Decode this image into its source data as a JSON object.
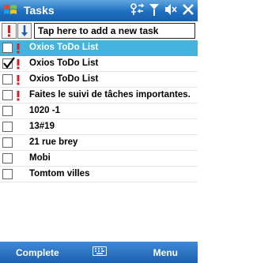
{
  "title_bar": {
    "title": "Tasks",
    "icons": [
      "windows-flag-icon",
      "connectivity-icon",
      "signal-icon",
      "volume-icon",
      "close-icon"
    ]
  },
  "toolbar": {
    "priority_icon": "exclamation-icon",
    "sort_icon": "sort-arrow-icon",
    "new_task_placeholder": "Tap here to add a new task"
  },
  "tasks": [
    {
      "label": "Oxios ToDo List",
      "checked": false,
      "high_priority": true,
      "selected": true
    },
    {
      "label": "Oxios ToDo List",
      "checked": true,
      "high_priority": true,
      "selected": false
    },
    {
      "label": "Oxios ToDo List",
      "checked": false,
      "high_priority": true,
      "selected": false
    },
    {
      "label": "Faites le suivi de tâches importantes.",
      "checked": false,
      "high_priority": true,
      "selected": false
    },
    {
      "label": "1020 -1",
      "checked": false,
      "high_priority": false,
      "selected": false
    },
    {
      "label": "13#19",
      "checked": false,
      "high_priority": false,
      "selected": false
    },
    {
      "label": "21 rue brey",
      "checked": false,
      "high_priority": false,
      "selected": false
    },
    {
      "label": "Mobi",
      "checked": false,
      "high_priority": false,
      "selected": false
    },
    {
      "label": "Tomtom villes",
      "checked": false,
      "high_priority": false,
      "selected": false
    }
  ],
  "softkeys": {
    "left": "Complete",
    "right": "Menu",
    "keyboard_icon": "keyboard-icon"
  },
  "colors": {
    "title_bar": "#1f6fc0",
    "selection": "#45b3de",
    "priority": "#d0202a"
  }
}
